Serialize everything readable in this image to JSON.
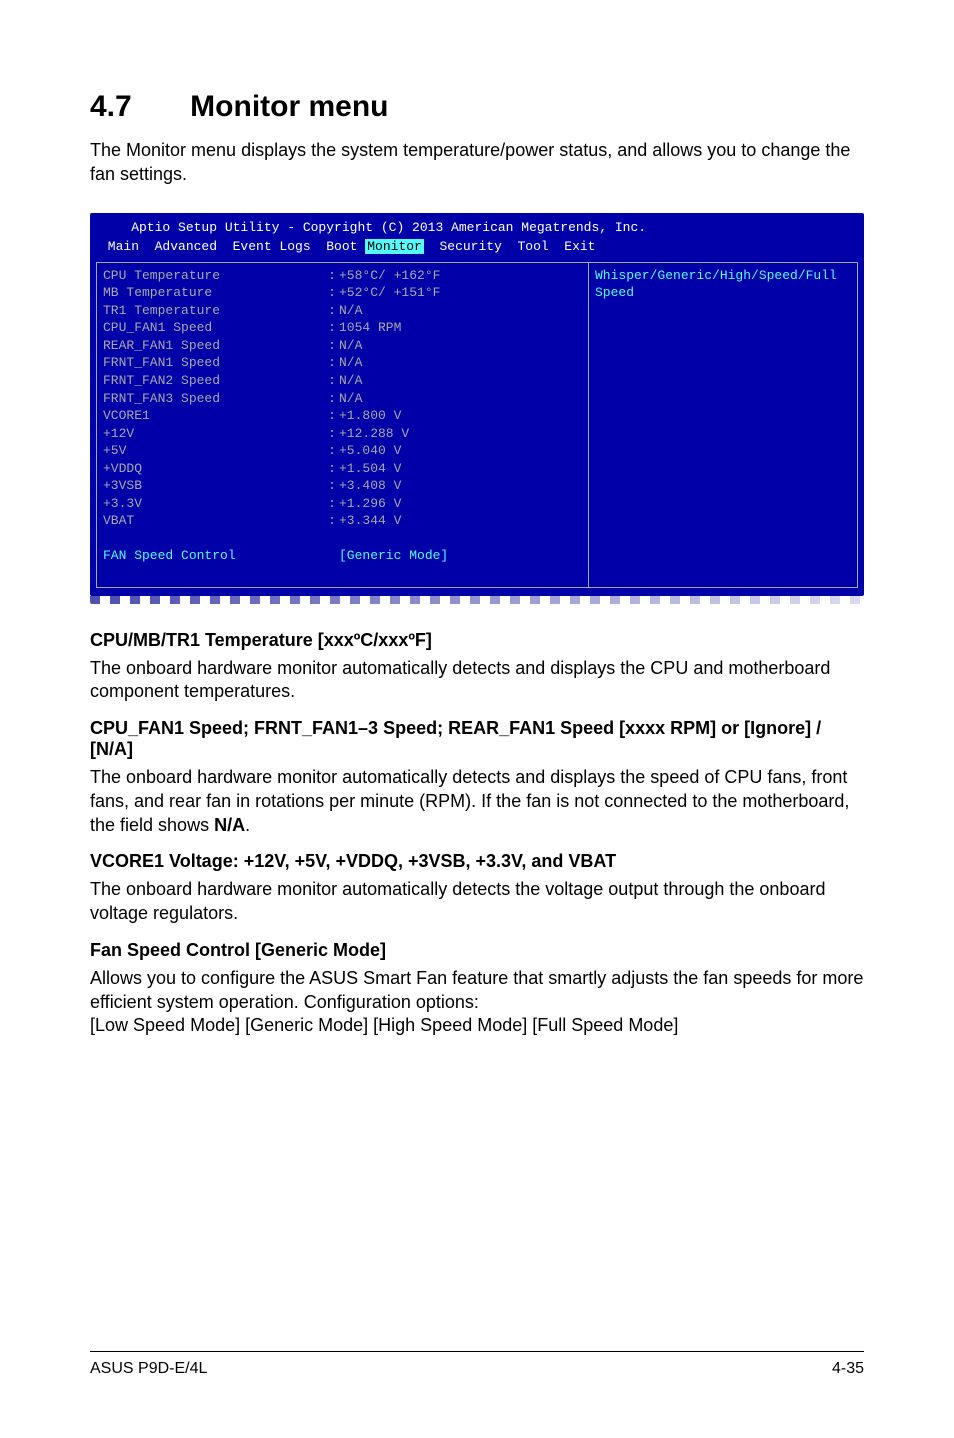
{
  "heading": {
    "number": "4.7",
    "title": "Monitor menu"
  },
  "intro": "The Monitor menu displays the system temperature/power status, and allows you to change the fan settings.",
  "bios": {
    "header": "    Aptio Setup Utility - Copyright (C) 2013 American Megatrends, Inc.",
    "tabs": {
      "pre": " Main  Advanced  Event Logs  Boot ",
      "selected": "Monitor",
      "post": "  Security  Tool  Exit"
    },
    "rows": [
      {
        "k": "CPU Temperature",
        "v": "+58°C/ +162°F"
      },
      {
        "k": "MB Temperature",
        "v": "+52°C/ +151°F"
      },
      {
        "k": "TR1 Temperature",
        "v": "N/A"
      },
      {
        "k": "CPU_FAN1 Speed",
        "v": "1054 RPM"
      },
      {
        "k": "REAR_FAN1 Speed",
        "v": "N/A"
      },
      {
        "k": "FRNT_FAN1 Speed",
        "v": "N/A"
      },
      {
        "k": "FRNT_FAN2 Speed",
        "v": "N/A"
      },
      {
        "k": "FRNT_FAN3 Speed",
        "v": "N/A"
      },
      {
        "k": "VCORE1",
        "v": "+1.800 V"
      },
      {
        "k": "+12V",
        "v": "+12.288 V"
      },
      {
        "k": "+5V",
        "v": "+5.040 V"
      },
      {
        "k": "+VDDQ",
        "v": "+1.504 V"
      },
      {
        "k": "+3VSB",
        "v": "+3.408 V"
      },
      {
        "k": "+3.3V",
        "v": "+1.296 V"
      },
      {
        "k": "VBAT",
        "v": "+3.344 V"
      }
    ],
    "control_row": {
      "k": "FAN Speed Control",
      "v": "[Generic Mode]"
    },
    "help": "Whisper/Generic/High/Speed/Full Speed"
  },
  "sections": [
    {
      "heading": "CPU/MB/TR1 Temperature [xxxºC/xxxºF]",
      "body": "The onboard hardware monitor automatically detects and displays the CPU and motherboard component temperatures."
    },
    {
      "heading": "CPU_FAN1 Speed; FRNT_FAN1–3 Speed; REAR_FAN1 Speed [xxxx RPM] or [Ignore] / [N/A]",
      "body_parts": [
        "The onboard hardware monitor automatically detects and displays the speed of CPU fans, front fans, and rear fan in rotations per minute (RPM). If the fan is not connected to the motherboard, the field shows ",
        "N/A",
        "."
      ]
    },
    {
      "heading": "VCORE1 Voltage: +12V, +5V, +VDDQ, +3VSB, +3.3V, and VBAT",
      "body": "The onboard hardware monitor automatically detects the voltage output through the onboard voltage regulators."
    },
    {
      "heading": "Fan Speed Control [Generic Mode]",
      "body": "Allows you to configure the ASUS Smart Fan feature that smartly adjusts the fan speeds for more efficient system operation. Configuration options:\n[Low Speed Mode] [Generic Mode] [High Speed Mode] [Full Speed Mode]"
    }
  ],
  "footer": {
    "left": "ASUS P9D-E/4L",
    "right": "4-35"
  }
}
